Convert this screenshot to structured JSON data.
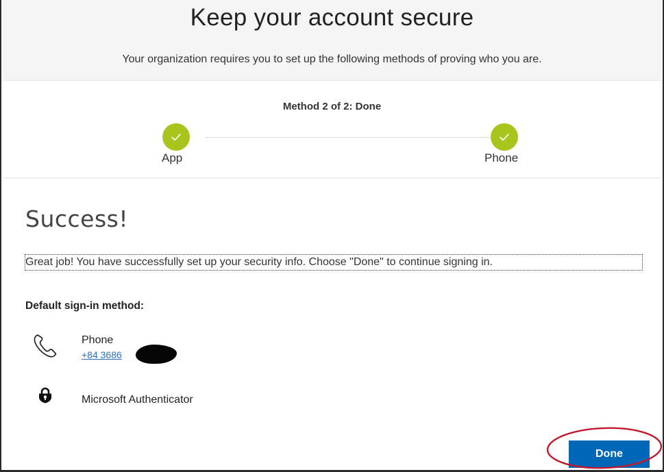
{
  "header": {
    "title": "Keep your account secure",
    "subtitle": "Your organization requires you to set up the following methods of proving who you are."
  },
  "stepper": {
    "method_label": "Method 2 of 2: Done",
    "steps": [
      {
        "label": "App",
        "status": "complete"
      },
      {
        "label": "Phone",
        "status": "complete"
      }
    ],
    "complete_color": "#a8c51e"
  },
  "content": {
    "success_title": "Success!",
    "success_message": "Great job! You have successfully set up your security info. Choose \"Done\" to continue signing in.",
    "default_method_label": "Default sign-in method:",
    "methods": [
      {
        "icon": "phone-icon",
        "name": "Phone",
        "detail": "+84 3686"
      },
      {
        "icon": "authenticator-lock-icon",
        "name": "Microsoft Authenticator"
      }
    ]
  },
  "actions": {
    "done_label": "Done",
    "accent_color": "#0067b8",
    "annotation_color": "#c0182c"
  }
}
